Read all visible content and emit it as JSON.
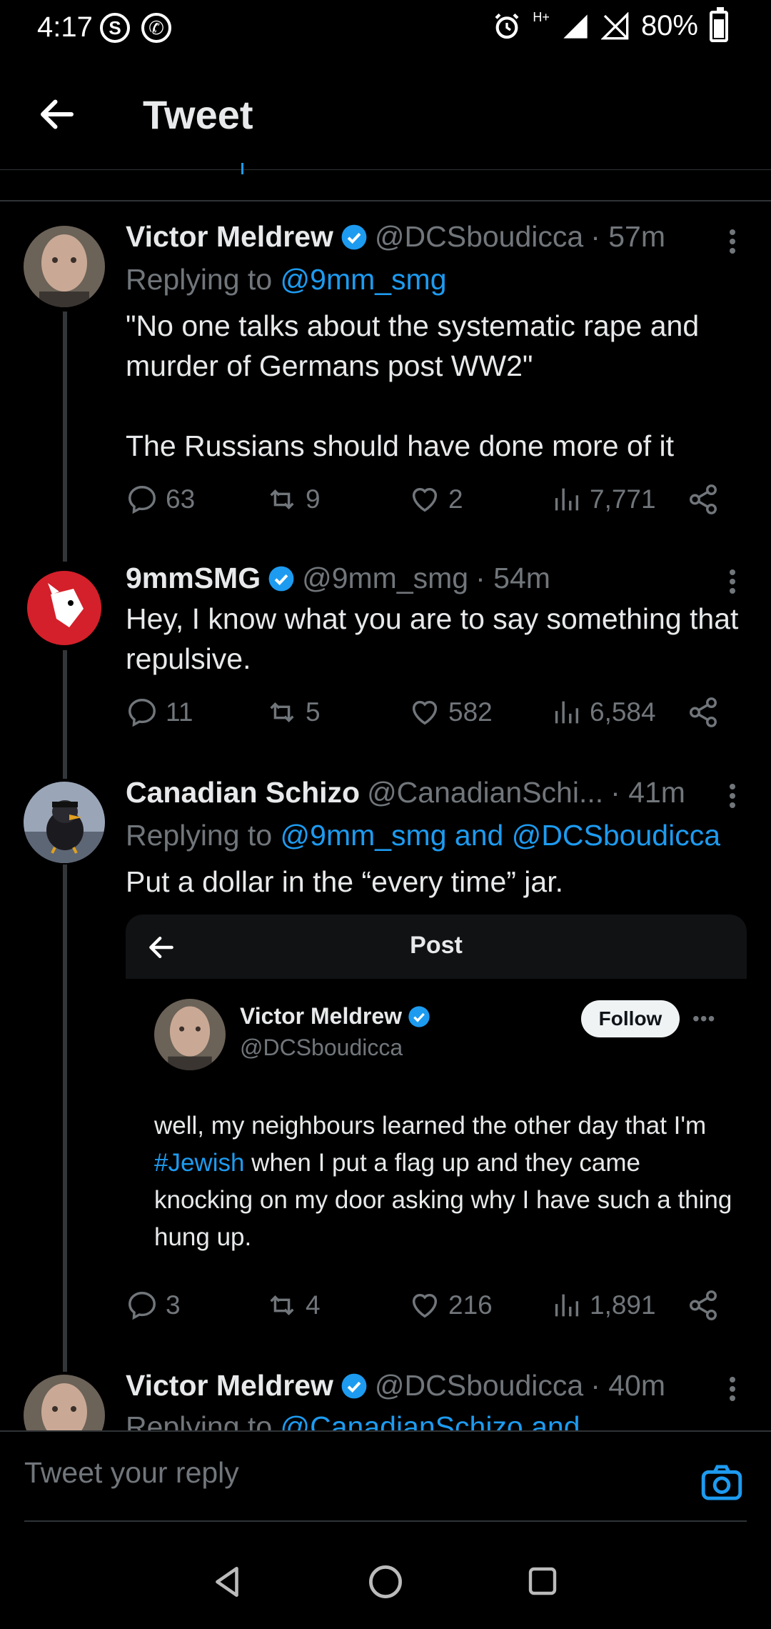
{
  "status_bar": {
    "time": "4:17",
    "battery": "80%",
    "network": "H+"
  },
  "header": {
    "title": "Tweet"
  },
  "tweets": [
    {
      "name": "Victor Meldrew",
      "handle": "@DCSboudicca",
      "time": "· 57m",
      "replying_label": "Replying to ",
      "replying_to": "@9mm_smg",
      "text": "\"No one talks about the systematic rape and murder of Germans post WW2\"\n\nThe Russians should have done more of it",
      "replies": "63",
      "retweets": "9",
      "likes": "2",
      "views": "7,771"
    },
    {
      "name": "9mmSMG",
      "handle": "@9mm_smg",
      "time": "· 54m",
      "text": "Hey, I know what you are to say something that repulsive.",
      "replies": "11",
      "retweets": "5",
      "likes": "582",
      "views": "6,584"
    },
    {
      "name": "Canadian Schizo",
      "handle": "@CanadianSchi...",
      "time": "· 41m",
      "replying_label": "Replying to ",
      "replying_to": "@9mm_smg and @DCSboudicca",
      "text": "Put a dollar in the “every time” jar.",
      "replies": "3",
      "retweets": "4",
      "likes": "216",
      "views": "1,891"
    },
    {
      "name": "Victor Meldrew",
      "handle": "@DCSboudicca",
      "time": "· 40m",
      "replying_label": "Replying to ",
      "replying_to": "@CanadianSchizo and"
    }
  ],
  "embedded_card": {
    "title": "Post",
    "name": "Victor Meldrew",
    "handle": "@DCSboudicca",
    "follow_label": "Follow",
    "text_before": "well, my neighbours learned the other day that I'm ",
    "hashtag": "#Jewish",
    "text_after": " when I put a flag up and they came knocking on my door asking why I have such a thing hung up."
  },
  "reply_bar": {
    "placeholder": "Tweet your reply"
  },
  "colors": {
    "background": "#000000",
    "accent": "#1d9bf0",
    "muted": "#71767b",
    "text": "#e7e9ea"
  }
}
